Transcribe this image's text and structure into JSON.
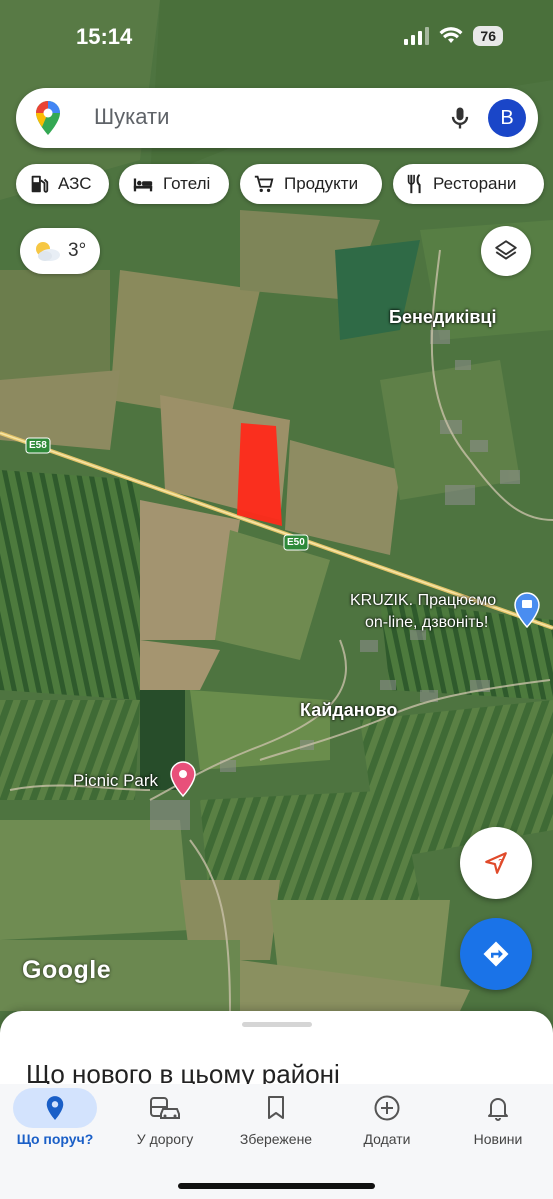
{
  "status_bar": {
    "time": "15:14",
    "battery": "76"
  },
  "search": {
    "placeholder": "Шукати",
    "avatar_initial": "B"
  },
  "chips": [
    {
      "label": "АЗС",
      "icon": "gas-station-icon"
    },
    {
      "label": "Готелі",
      "icon": "hotel-bed-icon"
    },
    {
      "label": "Продукти",
      "icon": "shopping-cart-icon"
    },
    {
      "label": "Ресторани",
      "icon": "fork-knife-icon"
    }
  ],
  "weather": {
    "temperature": "3°",
    "icon": "partly-cloudy-icon"
  },
  "map": {
    "labels": {
      "village_north": "Бенедиківці",
      "village_center": "Кайданово",
      "poi_park": "Picnic Park",
      "poi_shop_line1": "KRUZIK. Працюємо",
      "poi_shop_line2": "on-line, дзвоніть!",
      "road_e58": "E58",
      "road_e50": "E50"
    },
    "highlight_color": "#ff2a1a",
    "google_logo": "Google"
  },
  "sheet": {
    "title": "Що нового в цьому районі"
  },
  "nav": [
    {
      "label": "Що поруч?",
      "icon": "location-pin-icon",
      "active": true
    },
    {
      "label": "У дорогу",
      "icon": "commute-car-icon",
      "active": false
    },
    {
      "label": "Збережене",
      "icon": "bookmark-icon",
      "active": false
    },
    {
      "label": "Додати",
      "icon": "add-circle-icon",
      "active": false
    },
    {
      "label": "Новини",
      "icon": "bell-icon",
      "active": false
    }
  ],
  "colors": {
    "accent": "#1a73e8",
    "active_nav_bg": "#d3e3fd",
    "avatar_bg": "#1a46c8"
  }
}
